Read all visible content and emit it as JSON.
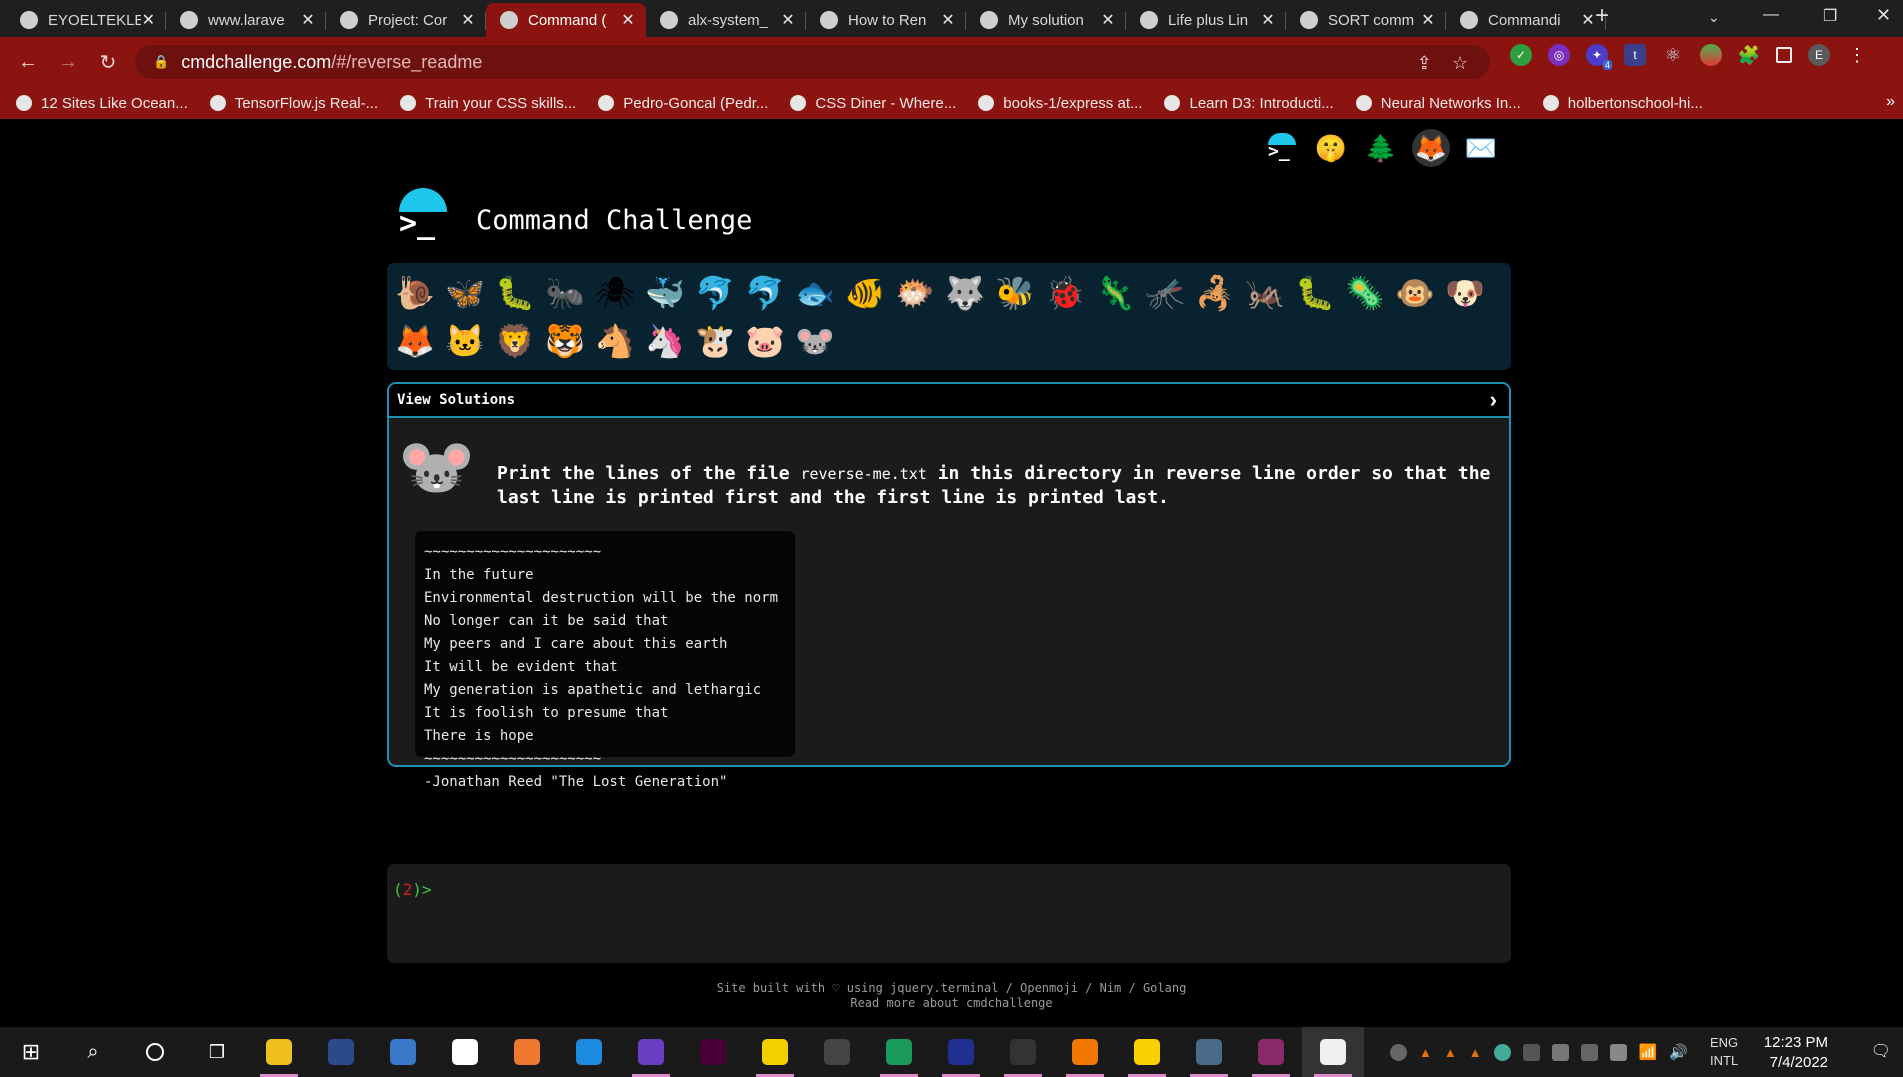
{
  "browser": {
    "tabs": [
      {
        "title": "EYOELTEKLE",
        "icon": "github-icon",
        "active": false
      },
      {
        "title": "www.larave",
        "icon": "globe-icon",
        "active": false
      },
      {
        "title": "Project: Cor",
        "icon": "project-icon",
        "active": false
      },
      {
        "title": "Command (",
        "icon": "terminal-icon",
        "active": true
      },
      {
        "title": "alx-system_",
        "icon": "github-icon",
        "active": false
      },
      {
        "title": "How to Ren",
        "icon": "page-icon",
        "active": false
      },
      {
        "title": "My solution",
        "icon": "medium-icon",
        "active": false
      },
      {
        "title": "Life plus Lin",
        "icon": "linux-icon",
        "active": false
      },
      {
        "title": "SORT comm",
        "icon": "link-icon",
        "active": false
      },
      {
        "title": "Commandi",
        "icon": "medium-icon",
        "active": false
      }
    ],
    "new_tab": "+",
    "url_host": "cmdchallenge.com",
    "url_path": "/#/reverse_readme",
    "extension_badge": "4",
    "profile_initial": "E",
    "bookmarks": [
      "12 Sites Like Ocean...",
      "TensorFlow.js Real-...",
      "Train your CSS skills...",
      "Pedro-Goncal (Pedr...",
      "CSS Diner - Where...",
      "books-1/express at...",
      "Learn D3: Introducti...",
      "Neural Networks In...",
      "holbertonschool-hi..."
    ]
  },
  "page": {
    "title": "Command Challenge",
    "view_solutions": "View Solutions",
    "description_part1": "Print the lines of the file ",
    "description_file": "reverse-me.txt",
    "description_part2": " in this directory in reverse line order so that the last line is printed first and the first line is printed last.",
    "file_lines": [
      "~~~~~~~~~~~~~~~~~~~~~",
      "In the future",
      "Environmental destruction will be the norm",
      "No longer can it be said that",
      "My peers and I care about this earth",
      "It will be evident that",
      "My generation is apathetic and lethargic",
      "It is foolish to presume that",
      "There is hope",
      "~~~~~~~~~~~~~~~~~~~~~",
      "-Jonathan Reed \"The Lost Generation\""
    ],
    "terminal_open": "(",
    "terminal_num": "2",
    "terminal_close": ")>",
    "footer_line1": "Site built with ♡ using jquery.terminal / Openmoji / Nim / Golang",
    "footer_line2": "Read more about cmdchallenge",
    "animals_row1": [
      "🐌",
      "🦋",
      "🐛",
      "🐜",
      "🕷",
      "🐳",
      "🐬",
      "🐬",
      "🐟",
      "🐠",
      "🐡",
      "🐺",
      "🐝",
      "🐞",
      "🦎",
      "🦟",
      "🦂",
      "🦗",
      "🐛",
      "🦠",
      "🐵",
      "🐶"
    ],
    "animals_row2": [
      "🦊",
      "🐱",
      "🦁",
      "🐯",
      "🐴",
      "🦄",
      "🐮",
      "🐷",
      "🐭"
    ]
  },
  "taskbar": {
    "apps": [
      "file-explorer",
      "atom",
      "qbittorrent",
      "7zip",
      "xampp",
      "19",
      "podcast",
      "adobe-xd",
      "notepad",
      "wifi",
      "edge",
      "6",
      "terminal",
      "vlc",
      "sticky-notes",
      "laptop",
      "winrar",
      "chrome"
    ],
    "language": "ENG",
    "layout": "INTL",
    "time": "12:23 PM",
    "date": "7/4/2022"
  },
  "colors": {
    "chrome_red": "#8b1411",
    "accent_blue": "#1d8fb0",
    "logo_cyan": "#1ec6ea",
    "prompt_green": "#3ec63e",
    "prompt_red": "#d02020"
  }
}
